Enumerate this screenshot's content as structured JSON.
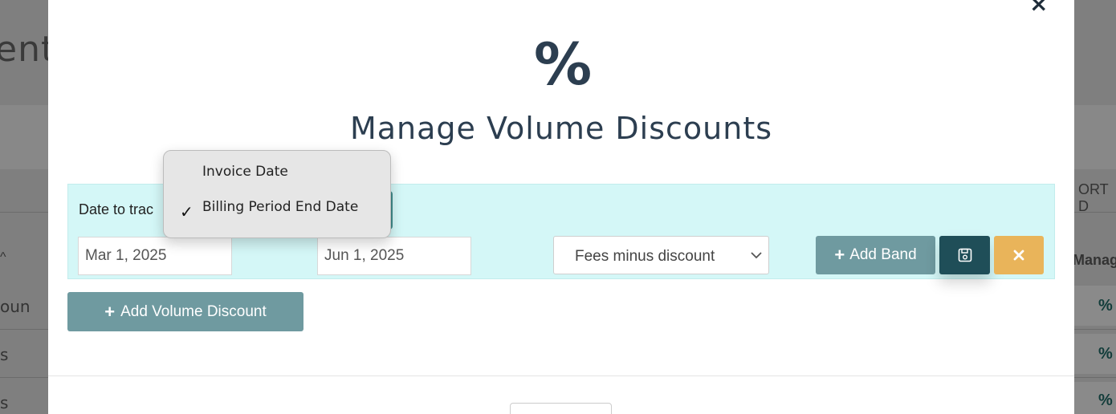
{
  "background": {
    "title_fragment": "ent",
    "row_fragments": [
      "oun",
      "s",
      "s"
    ],
    "right_header_fragment": "ORT D",
    "right_manage_fragment": "Manag",
    "right_icon": "%"
  },
  "modal": {
    "close_label": "×",
    "icon": "%",
    "title": "Manage Volume Discounts",
    "date_track_label": "Date to trac",
    "start_date": "Mar 1, 2025",
    "end_date": "Jun 1, 2025",
    "calculation_select": {
      "selected": "Fees minus discount"
    },
    "add_band_label": "Add Band",
    "add_volume_discount_label": "Add Volume Discount",
    "save_icon": "floppy-disk-icon",
    "cancel_icon": "close-icon"
  },
  "dropdown": {
    "options": [
      {
        "label": "Invoice Date",
        "selected": false
      },
      {
        "label": "Billing Period End Date",
        "selected": true
      }
    ],
    "check_mark": "✓"
  },
  "colors": {
    "panel_bg": "#d4f7f7",
    "primary_teal": "#6f9aa0",
    "save_dark": "#1f4e58",
    "cancel_orange": "#e9b45a",
    "title_color": "#2c3e50"
  }
}
